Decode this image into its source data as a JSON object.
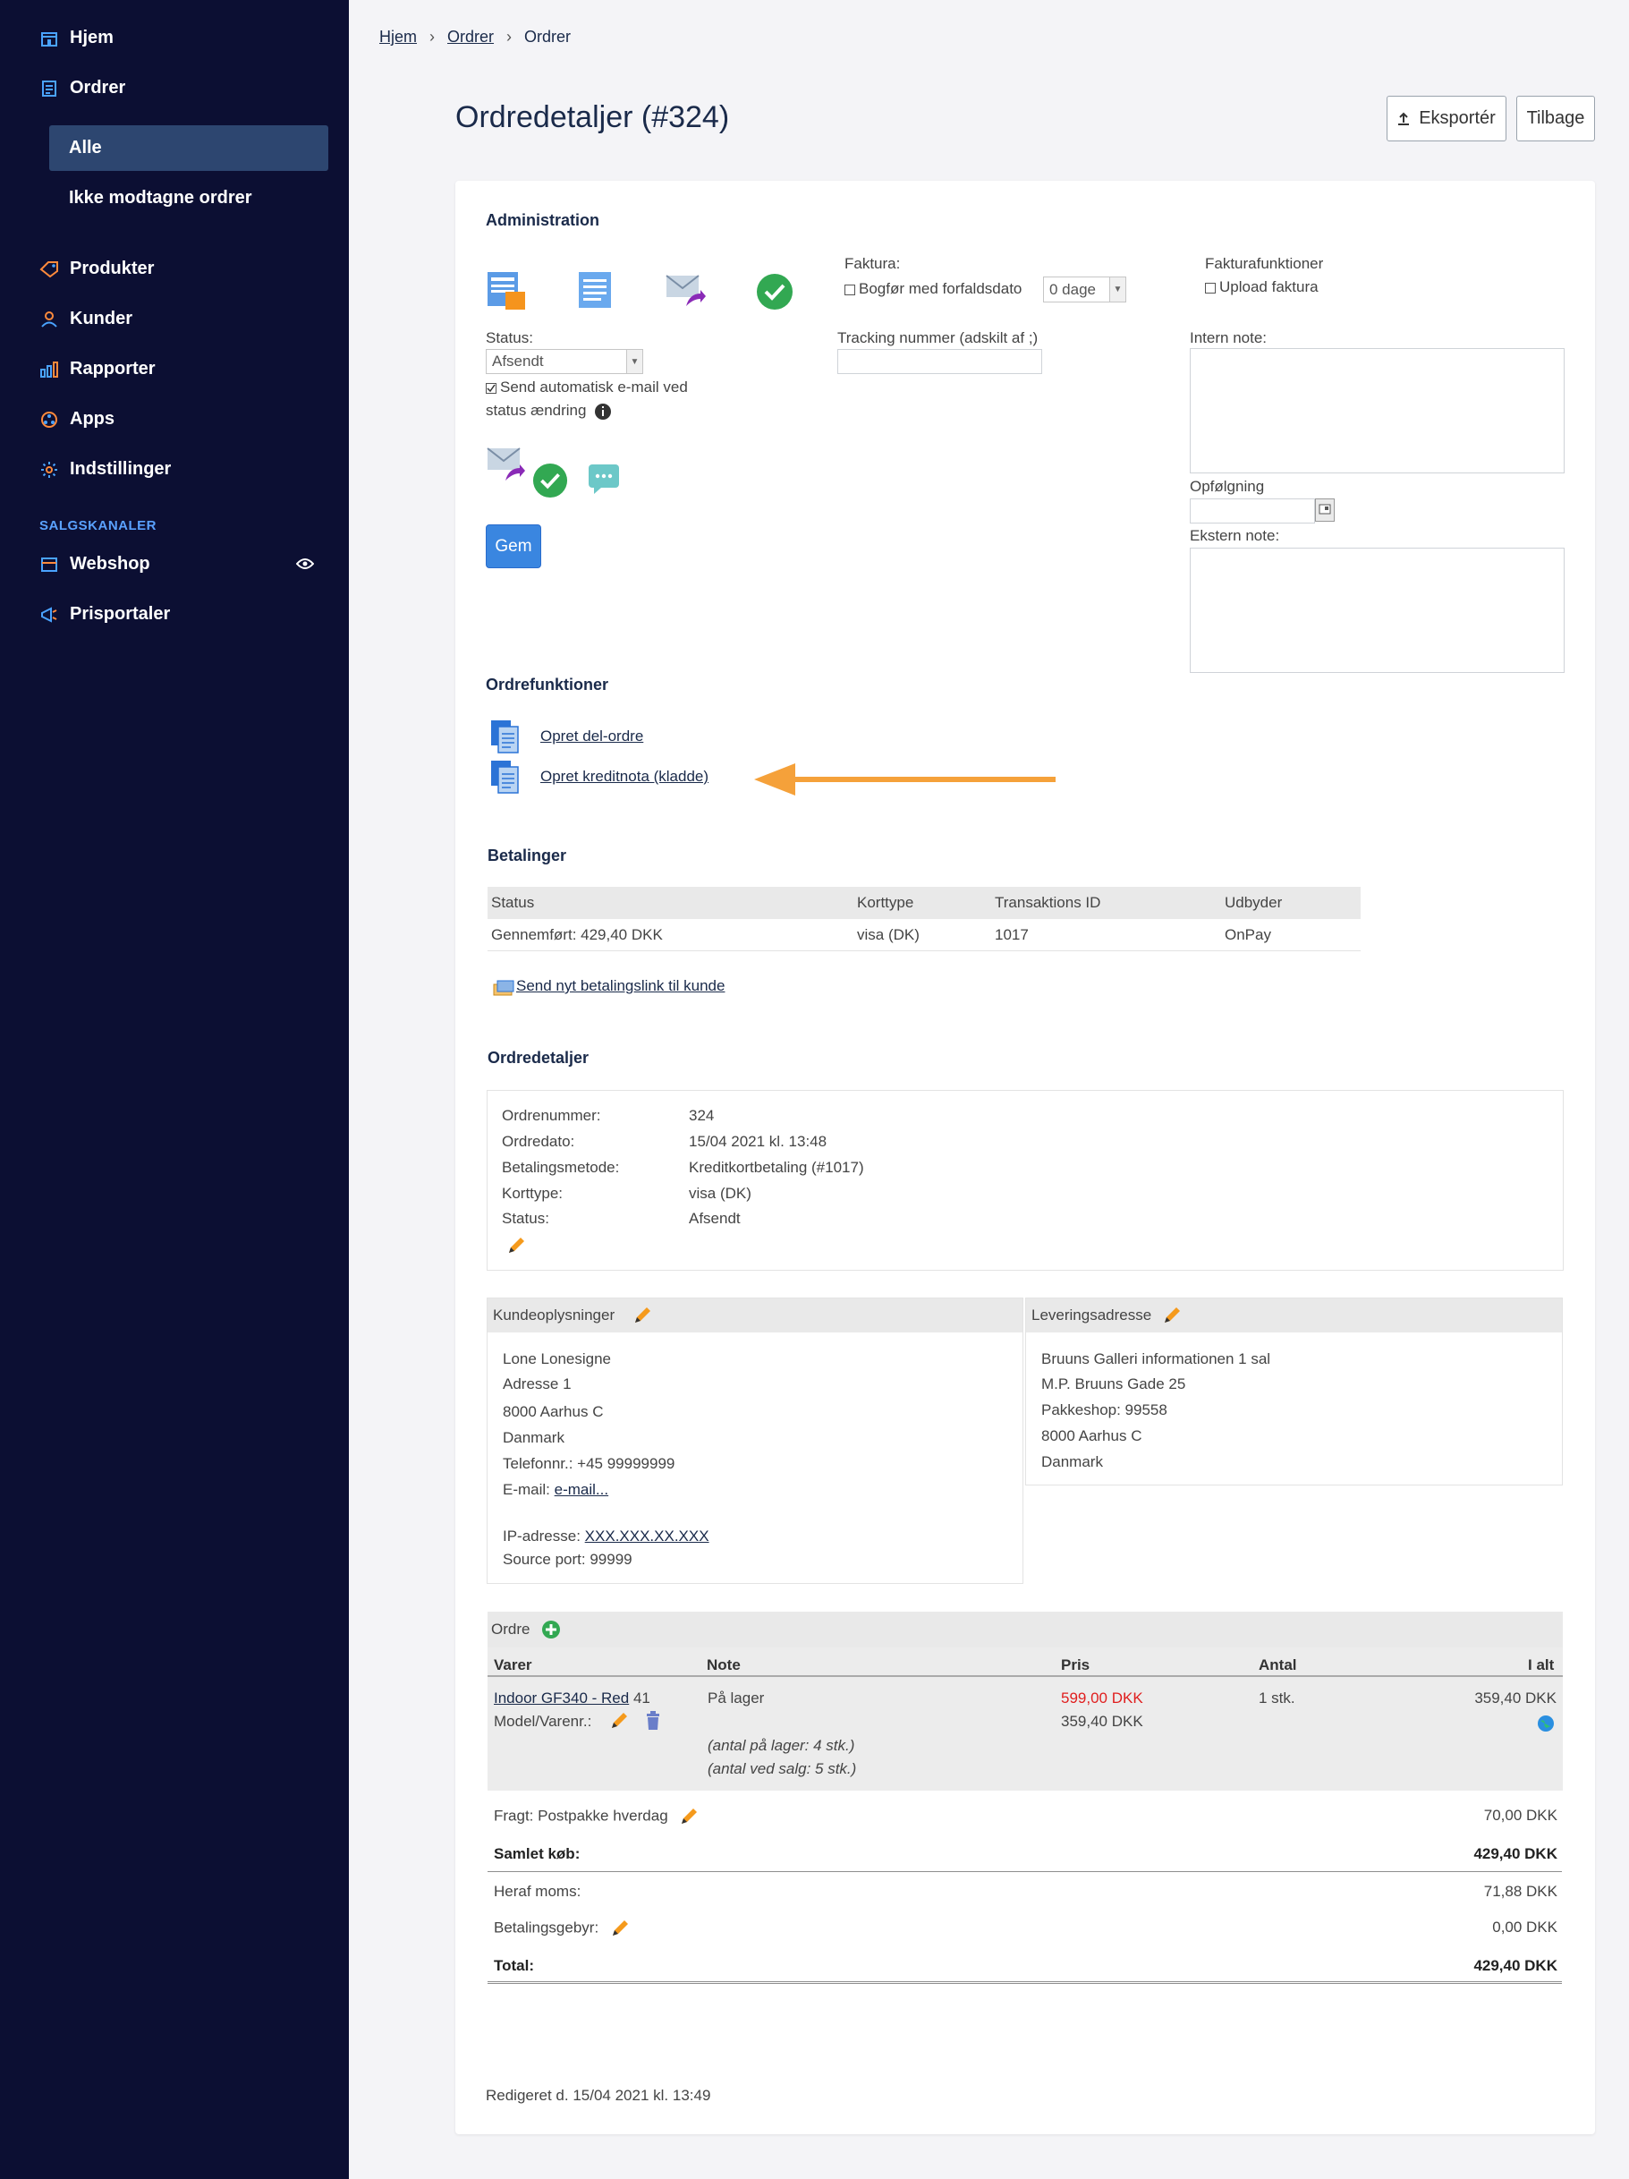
{
  "sidebar": {
    "items": [
      {
        "label": "Hjem"
      },
      {
        "label": "Ordrer"
      },
      {
        "label": "Produkter"
      },
      {
        "label": "Kunder"
      },
      {
        "label": "Rapporter"
      },
      {
        "label": "Apps"
      },
      {
        "label": "Indstillinger"
      }
    ],
    "sub_items": [
      {
        "label": "Alle"
      },
      {
        "label": "Ikke modtagne ordrer"
      }
    ],
    "section_label": "SALGSKANALER",
    "channels": [
      {
        "label": "Webshop"
      },
      {
        "label": "Prisportaler"
      }
    ]
  },
  "breadcrumb": [
    "Hjem",
    "Ordrer",
    "Ordrer"
  ],
  "page_title": "Ordredetaljer (#324)",
  "buttons": {
    "export": "Eksportér",
    "back": "Tilbage",
    "save": "Gem"
  },
  "admin": {
    "heading": "Administration",
    "invoice_label": "Faktura:",
    "post_due_label": "Bogfør med forfaldsdato",
    "due_days_value": "0 dage",
    "invoice_functions_label": "Fakturafunktioner",
    "upload_invoice_label": "Upload faktura",
    "status_label": "Status:",
    "status_value": "Afsendt",
    "auto_email_label_1": "Send automatisk e-mail ved",
    "auto_email_label_2": "status ændring",
    "tracking_label": "Tracking nummer (adskilt af ;)",
    "internal_note_label": "Intern note:",
    "followup_label": "Opfølgning",
    "external_note_label": "Ekstern note:"
  },
  "order_functions": {
    "heading": "Ordrefunktioner",
    "create_partial": "Opret del-ordre",
    "create_credit": "Opret kreditnota (kladde)"
  },
  "payments": {
    "heading": "Betalinger",
    "columns": [
      "Status",
      "Korttype",
      "Transaktions ID",
      "Udbyder"
    ],
    "rows": [
      [
        "Gennemført: 429,40 DKK",
        "visa (DK)",
        "1017",
        "OnPay"
      ]
    ],
    "send_link": "Send nyt betalingslink til kunde"
  },
  "order_details": {
    "heading": "Ordredetaljer",
    "rows": [
      {
        "label": "Ordrenummer:",
        "value": "324"
      },
      {
        "label": "Ordredato:",
        "value": "15/04 2021 kl. 13:48"
      },
      {
        "label": "Betalingsmetode:",
        "value": "Kreditkortbetaling (#1017)"
      },
      {
        "label": "Korttype:",
        "value": "visa (DK)"
      },
      {
        "label": "Status:",
        "value": "Afsendt"
      }
    ]
  },
  "customer": {
    "heading": "Kundeoplysninger",
    "name": "Lone Lonesigne",
    "address": "Adresse 1",
    "city": "8000 Aarhus C",
    "country": "Danmark",
    "phone": "Telefonnr.: +45 99999999",
    "email_label": "E-mail:",
    "email_link": "e-mail...",
    "ip_label": "IP-adresse:",
    "ip_value": "XXX.XXX.XX.XXX",
    "source_port": "Source port: 99999"
  },
  "delivery": {
    "heading": "Leveringsadresse",
    "lines": [
      "Bruuns Galleri informationen 1 sal",
      "M.P. Bruuns Gade 25",
      "Pakkeshop: 99558",
      "8000 Aarhus C",
      "Danmark"
    ]
  },
  "order": {
    "heading": "Ordre",
    "columns": [
      "Varer",
      "Note",
      "Pris",
      "Antal",
      "I alt"
    ],
    "item": {
      "name": "Indoor GF340 - Red",
      "number": "41",
      "model_label": "Model/Varenr.:",
      "note": "På lager",
      "stock_note_1": "(antal på lager: 4 stk.)",
      "stock_note_2": "(antal ved salg: 5 stk.)",
      "price_original": "599,00 DKK",
      "price": "359,40 DKK",
      "qty": "1 stk.",
      "total": "359,40 DKK"
    },
    "shipping_label": "Fragt: Postpakke hverdag",
    "shipping_value": "70,00 DKK",
    "subtotal_label": "Samlet køb:",
    "subtotal_value": "429,40 DKK",
    "vat_label": "Heraf moms:",
    "vat_value": "71,88 DKK",
    "fee_label": "Betalingsgebyr:",
    "fee_value": "0,00 DKK",
    "total_label": "Total:",
    "total_value": "429,40 DKK"
  },
  "edited": "Redigeret d. 15/04 2021 kl. 13:49",
  "colors": {
    "sidebar": "#0c0f33",
    "accent": "#3a86e0",
    "arrow": "#f5a13a",
    "price_red": "#e01e1e"
  }
}
